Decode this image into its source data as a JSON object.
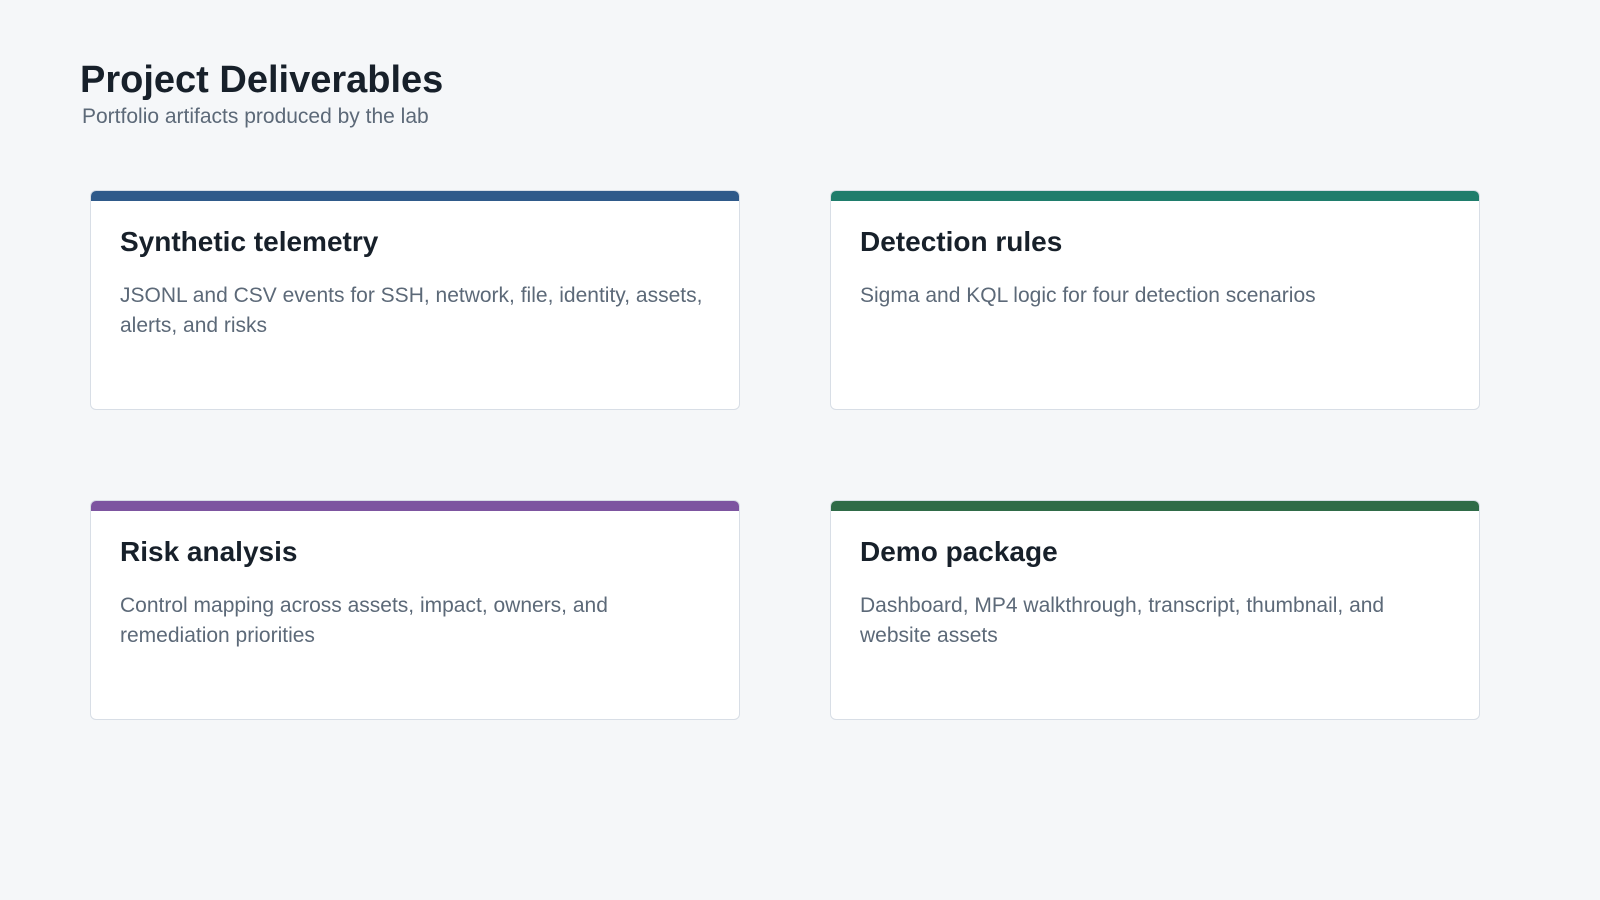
{
  "header": {
    "title": "Project Deliverables",
    "subtitle": "Portfolio artifacts produced by the lab"
  },
  "cards": [
    {
      "title": "Synthetic telemetry",
      "description": "JSONL and CSV events for SSH, network, file, identity, assets, alerts, and risks",
      "accent_color": "#2f5a8a"
    },
    {
      "title": "Detection rules",
      "description": "Sigma and KQL logic for four detection scenarios",
      "accent_color": "#1f7d6c"
    },
    {
      "title": "Risk analysis",
      "description": "Control mapping across assets, impact, owners, and remediation priorities",
      "accent_color": "#7d55a0"
    },
    {
      "title": "Demo package",
      "description": "Dashboard, MP4 walkthrough, transcript, thumbnail, and website assets",
      "accent_color": "#2f6b48"
    }
  ]
}
